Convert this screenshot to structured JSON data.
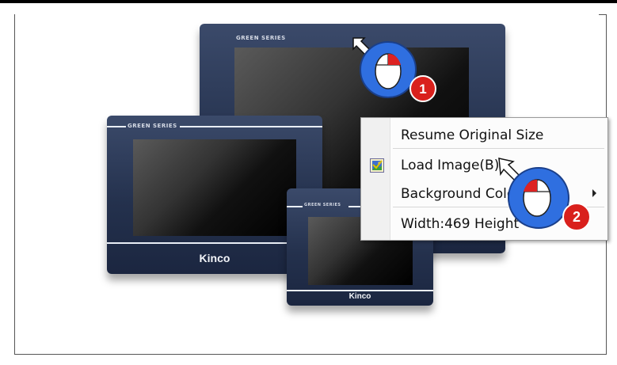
{
  "hmi_large": {
    "series": "GREEN SERIES"
  },
  "hmi_medium": {
    "series": "GREEN SERIES",
    "brand": "Kinco"
  },
  "hmi_small": {
    "series": "GREEN SERIES",
    "brand": "Kinco"
  },
  "context_menu": {
    "items": [
      {
        "label": "Resume Original Size",
        "icon": null
      },
      {
        "label": "Load Image(B)",
        "icon": "image-checkbox-icon"
      },
      {
        "label": "Background Color",
        "icon": null,
        "has_submenu": true
      },
      {
        "label": "Width:469 Height",
        "icon": null
      }
    ]
  },
  "callouts": {
    "step1": {
      "number": "1",
      "icon": "mouse-left-click-icon"
    },
    "step2": {
      "number": "2",
      "icon": "mouse-left-click-icon"
    }
  },
  "colors": {
    "callout_blue": "#2f6fe0",
    "badge_red": "#d9201c",
    "panel_navy": "#24314d"
  }
}
